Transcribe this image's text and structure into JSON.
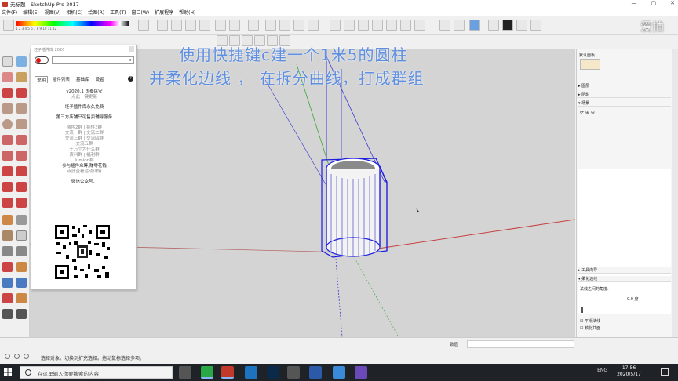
{
  "window": {
    "title": "无标题 - SketchUp Pro 2017",
    "controls": [
      "—",
      "▢",
      "✕"
    ]
  },
  "menu": [
    "文件(F)",
    "编辑(E)",
    "视图(V)",
    "相机(C)",
    "绘图(R)",
    "工具(T)",
    "窗口(W)",
    "扩展程序",
    "帮助(H)"
  ],
  "colorbar_numbers": "1 2 3 4 5 6 7 8 9 10 11 12",
  "overlay": {
    "line1": "使用快捷键c建一个1米5的圆柱",
    "line2": "并柔化边线 ， 在拆分曲线，打成群组"
  },
  "plugin_panel": {
    "title": "坯子插件库 2020",
    "tabs": [
      "说明",
      "插件列表",
      "基础库",
      "设置"
    ],
    "help": "?",
    "search_icon": "magnifier-icon",
    "body": [
      {
        "text": "v2020.1 国泰民安",
        "gray": false
      },
      {
        "text": "点此一键更新",
        "gray": true
      },
      {
        "text": "",
        "gray": false
      },
      {
        "text": "坯子插件库永久免费",
        "gray": false
      },
      {
        "text": "",
        "gray": false
      },
      {
        "text": "第三方店铺只可售卖辅导服务",
        "gray": false
      },
      {
        "text": "",
        "gray": false
      },
      {
        "text": "插件2群 | 插件3群",
        "gray": true
      },
      {
        "text": "交流一群 | 交流二群",
        "gray": true
      },
      {
        "text": "交流三群 | 交流四群",
        "gray": true
      },
      {
        "text": "交流五群",
        "gray": true
      },
      {
        "text": "十万个为什么群",
        "gray": true
      },
      {
        "text": "资料群 | 福利群",
        "gray": true
      },
      {
        "text": "lumion群",
        "gray": true
      },
      {
        "text": "参与插件众筹,赚零花钱",
        "gray": false
      },
      {
        "text": "点此查看活动详情",
        "gray": true
      },
      {
        "text": "",
        "gray": false
      },
      {
        "text": "微信公众号：",
        "gray": false
      }
    ]
  },
  "right_panel": {
    "thumb_label": "默认面板",
    "sections": [
      "▸ 图层",
      "▸ 阴影",
      "▾ 场景"
    ],
    "bottom_sections": [
      "▸ 工具向导",
      "▾ 柔化边线"
    ],
    "soften": {
      "angle_label": "法线之间的角度:",
      "angle_value": "0.0",
      "angle_unit": "度",
      "smooth_normals": "平滑法线",
      "soften_coplanar": "软化共面",
      "smooth_checked": true,
      "coplanar_checked": false
    }
  },
  "status": {
    "message": "选择对象。切换到扩充选择。拖动鼠标选择多项。",
    "vcb_label": "数值"
  },
  "taskbar": {
    "search_placeholder": "在这里输入你要搜索的内容",
    "tray": "ENG",
    "time": "17:56",
    "date": "2020/5/17"
  },
  "watermark": "爱拍",
  "colors": {
    "selection_blue": "#1d1de0",
    "overlay_text": "#5e8fe0",
    "axis_red": "#c84040",
    "axis_green": "#3aa83a",
    "axis_blue": "#3a3ad0",
    "toggle_red": "#dd1111"
  }
}
